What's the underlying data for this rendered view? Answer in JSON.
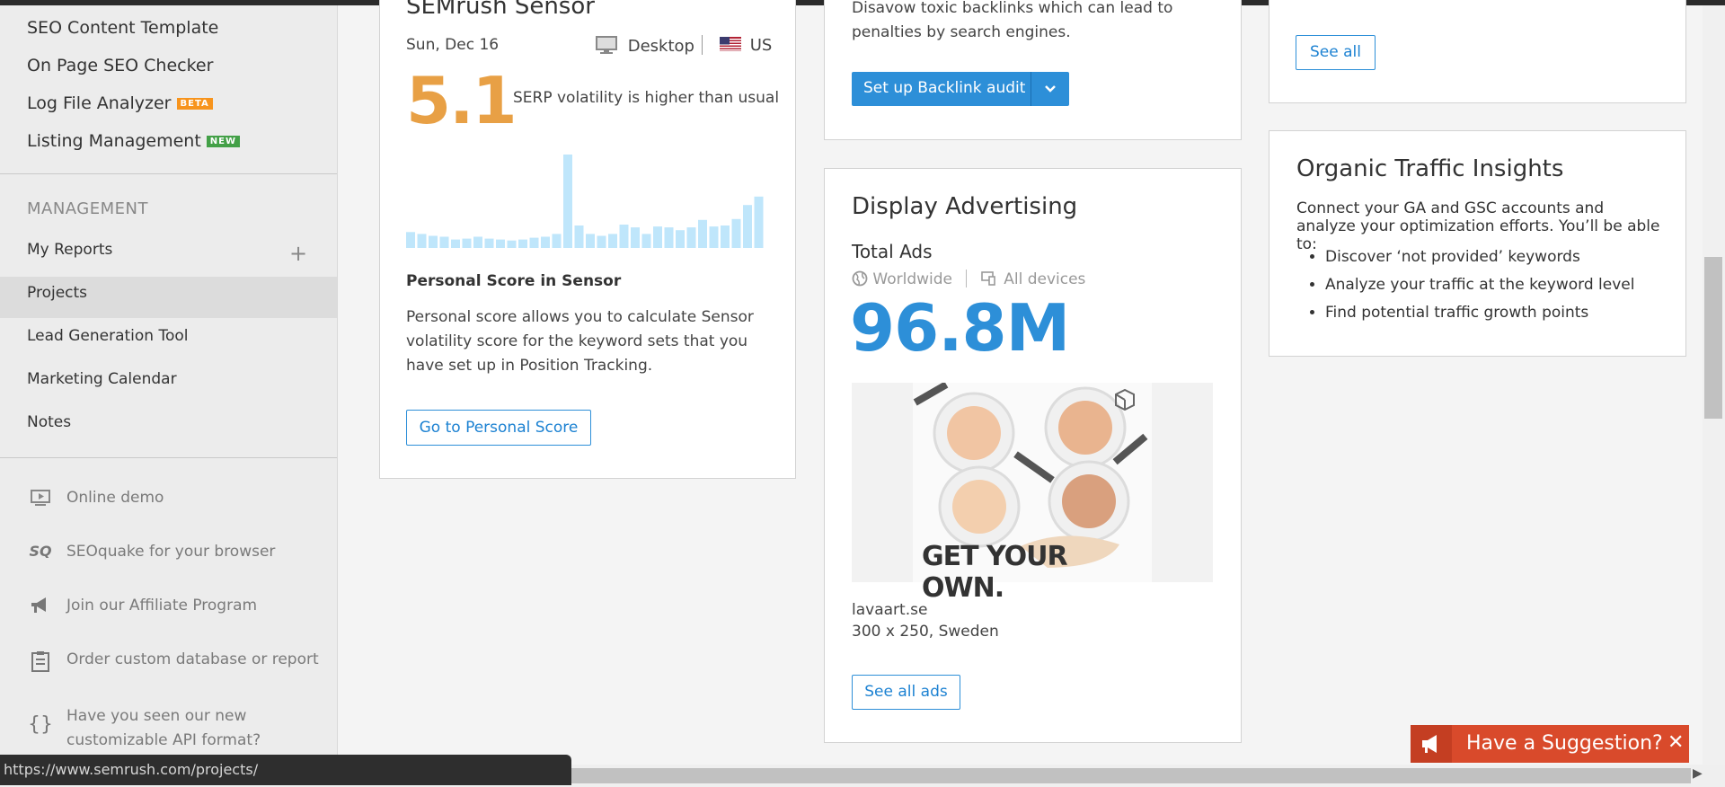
{
  "status_url": "https://www.semrush.com/projects/",
  "sidebar": {
    "top_items": [
      {
        "label": "SEO Content Template"
      },
      {
        "label": "On Page SEO Checker"
      },
      {
        "label": "Log File Analyzer",
        "badge": "BETA"
      },
      {
        "label": "Listing Management",
        "badge": "NEW"
      }
    ],
    "section_title": "MANAGEMENT",
    "management_items": [
      {
        "label": "My Reports"
      },
      {
        "label": "Projects"
      },
      {
        "label": "Lead Generation Tool"
      },
      {
        "label": "Marketing Calendar"
      },
      {
        "label": "Notes"
      }
    ],
    "footer_items": [
      {
        "label": "Online demo",
        "icon": "monitor-icon"
      },
      {
        "label": "SEOquake for your browser",
        "icon": "seoquake-icon"
      },
      {
        "label": "Join our Affiliate Program",
        "icon": "megaphone-icon"
      },
      {
        "label": "Order custom database or report",
        "icon": "clipboard-icon"
      },
      {
        "label": "Have you seen our new customizable API format?",
        "icon": "curly-braces-icon"
      }
    ]
  },
  "sensor": {
    "title": "SEMrush Sensor",
    "date": "Sun, Dec 16",
    "device": "Desktop",
    "country": "US",
    "score": "5.1",
    "note": "SERP volatility is higher than usual",
    "history": [
      0.17,
      0.15,
      0.13,
      0.12,
      0.09,
      0.1,
      0.12,
      0.1,
      0.09,
      0.08,
      0.09,
      0.11,
      0.12,
      0.15,
      1.0,
      0.24,
      0.15,
      0.13,
      0.15,
      0.25,
      0.22,
      0.15,
      0.23,
      0.22,
      0.19,
      0.22,
      0.3,
      0.23,
      0.24,
      0.31,
      0.46,
      0.55
    ],
    "personal_title": "Personal Score in Sensor",
    "personal_text": "Personal score allows you to calculate Sensor volatility score for the keyword sets that you have set up in Position Tracking.",
    "button": "Go to Personal Score"
  },
  "backlink": {
    "text": "Disavow toxic backlinks which can lead to penalties by search engines.",
    "button": "Set up Backlink audit"
  },
  "third_col": {
    "see_all": "See all"
  },
  "display_ads": {
    "title": "Display Advertising",
    "subtitle": "Total Ads",
    "region": "Worldwide",
    "devices": "All devices",
    "value": "96.8M",
    "ad_banner_text": "GET YOUR OWN.",
    "ad_domain": "lavaart.se",
    "ad_details": "300 x 250, Sweden",
    "button": "See all ads"
  },
  "organic": {
    "title": "Organic Traffic Insights",
    "text": "Connect your GA and GSC accounts and analyze your optimization efforts. You’ll be able to:",
    "bullets": [
      "Discover ‘not provided’ keywords",
      "Analyze your traffic at the keyword level",
      "Find potential traffic growth points"
    ]
  },
  "suggestion": {
    "label": "Have a Suggestion?",
    "close": "✕"
  },
  "colors": {
    "accent": "#2d8fd8",
    "score": "#e8a045",
    "suggest": "#d94a2b"
  }
}
